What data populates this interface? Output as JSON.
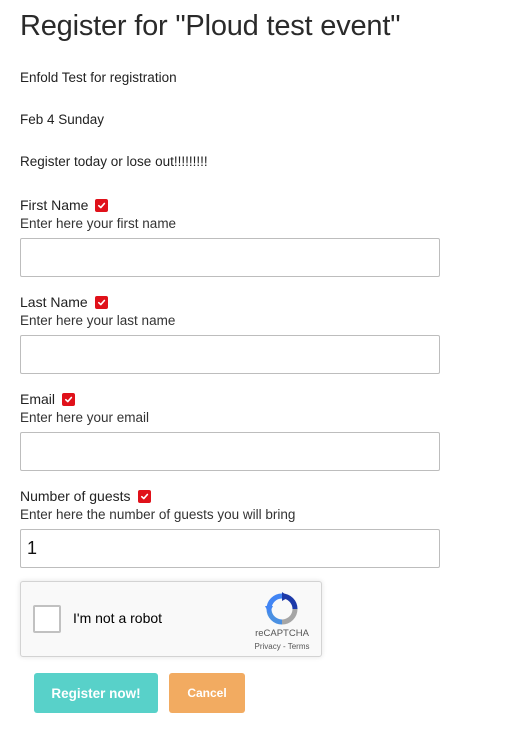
{
  "page": {
    "title": "Register for \"Ploud test event\"",
    "description": "Enfold Test for registration",
    "date": "Feb 4 Sunday",
    "tagline": "Register today or lose out!!!!!!!!!"
  },
  "form": {
    "fields": [
      {
        "label": "First Name",
        "help": "Enter here your first name",
        "value": ""
      },
      {
        "label": "Last Name",
        "help": "Enter here your last name",
        "value": ""
      },
      {
        "label": "Email",
        "help": "Enter here your email",
        "value": ""
      },
      {
        "label": "Number of guests",
        "help": "Enter here the number of guests you will bring",
        "value": "1"
      }
    ]
  },
  "captcha": {
    "label": "I'm not a robot",
    "brand": "reCAPTCHA",
    "links": "Privacy - Terms",
    "icon": "recaptcha-logo-icon"
  },
  "buttons": {
    "register": "Register now!",
    "cancel": "Cancel"
  },
  "colors": {
    "required_badge": "#e0111a",
    "register_button": "#58d1c9",
    "cancel_button": "#f2ab61"
  }
}
